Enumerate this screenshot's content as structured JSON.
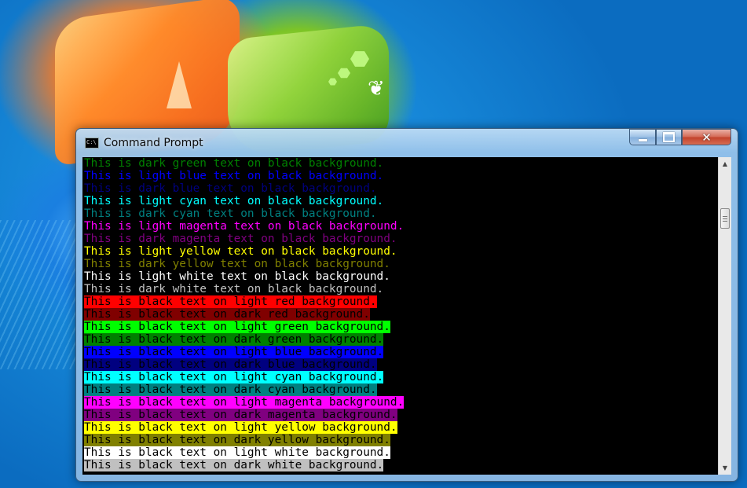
{
  "window": {
    "title": "Command Prompt",
    "icon": "console-app-icon",
    "icon_glyph": "C:\\"
  },
  "controls": {
    "minimize_icon": "minimize-icon",
    "maximize_icon": "maximize-icon",
    "close_icon": "close-icon",
    "close_glyph": "✕"
  },
  "scrollbar": {
    "up_glyph": "▲",
    "down_glyph": "▼",
    "position": 0.14
  },
  "console": {
    "lines": [
      {
        "text": "This is dark green text on black background.",
        "fg": "#008000",
        "bg": "#000000"
      },
      {
        "text": "This is light blue text on black background.",
        "fg": "#0000FF",
        "bg": "#000000"
      },
      {
        "text": "This is dark blue text on black background.",
        "fg": "#000080",
        "bg": "#000000"
      },
      {
        "text": "This is light cyan text on black background.",
        "fg": "#00FFFF",
        "bg": "#000000"
      },
      {
        "text": "This is dark cyan text on black background.",
        "fg": "#008080",
        "bg": "#000000"
      },
      {
        "text": "This is light magenta text on black background.",
        "fg": "#FF00FF",
        "bg": "#000000"
      },
      {
        "text": "This is dark magenta text on black background.",
        "fg": "#800080",
        "bg": "#000000"
      },
      {
        "text": "This is light yellow text on black background.",
        "fg": "#FFFF00",
        "bg": "#000000"
      },
      {
        "text": "This is dark yellow text on black background.",
        "fg": "#808000",
        "bg": "#000000"
      },
      {
        "text": "This is light white text on black background.",
        "fg": "#FFFFFF",
        "bg": "#000000"
      },
      {
        "text": "This is dark white text on black background.",
        "fg": "#C0C0C0",
        "bg": "#000000"
      },
      {
        "text": "This is black text on light red background.",
        "fg": "#000000",
        "bg": "#FF0000"
      },
      {
        "text": "This is black text on dark red background.",
        "fg": "#000000",
        "bg": "#800000"
      },
      {
        "text": "This is black text on light green background.",
        "fg": "#000000",
        "bg": "#00FF00"
      },
      {
        "text": "This is black text on dark green background.",
        "fg": "#000000",
        "bg": "#008000"
      },
      {
        "text": "This is black text on light blue background.",
        "fg": "#000000",
        "bg": "#0000FF"
      },
      {
        "text": "This is black text on dark blue background.",
        "fg": "#000000",
        "bg": "#000080"
      },
      {
        "text": "This is black text on light cyan background.",
        "fg": "#000000",
        "bg": "#00FFFF"
      },
      {
        "text": "This is black text on dark cyan background.",
        "fg": "#000000",
        "bg": "#008080"
      },
      {
        "text": "This is black text on light magenta background.",
        "fg": "#000000",
        "bg": "#FF00FF"
      },
      {
        "text": "This is black text on dark magenta background.",
        "fg": "#000000",
        "bg": "#800080"
      },
      {
        "text": "This is black text on light yellow background.",
        "fg": "#000000",
        "bg": "#FFFF00"
      },
      {
        "text": "This is black text on dark yellow background.",
        "fg": "#000000",
        "bg": "#808000"
      },
      {
        "text": "This is black text on light white background.",
        "fg": "#000000",
        "bg": "#FFFFFF"
      },
      {
        "text": "This is black text on dark white background.",
        "fg": "#000000",
        "bg": "#C0C0C0"
      }
    ]
  }
}
